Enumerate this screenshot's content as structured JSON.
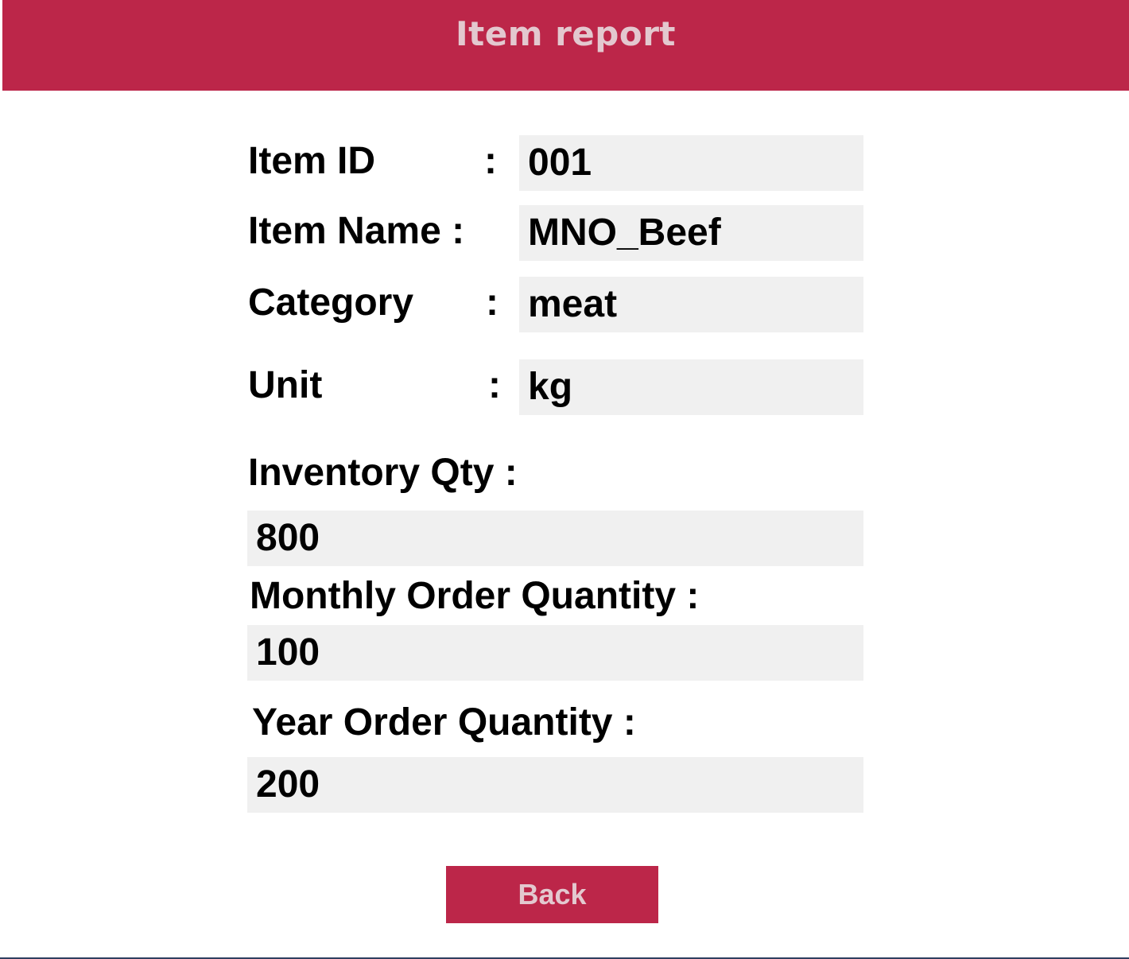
{
  "header": {
    "title": "Item report"
  },
  "fields": {
    "item_id": {
      "label": "Item ID",
      "colon": ":",
      "value": "001"
    },
    "item_name": {
      "label": "Item Name :",
      "value": "MNO_Beef"
    },
    "category": {
      "label": "Category",
      "colon": ":",
      "value": "meat"
    },
    "unit": {
      "label": "Unit",
      "colon": ":",
      "value": "kg"
    },
    "inventory_qty": {
      "label": "Inventory Qty :",
      "value": "800"
    },
    "monthly_order_qty": {
      "label": "Monthly Order Quantity :",
      "value": "100"
    },
    "year_order_qty": {
      "label": "Year Order Quantity :",
      "value": "200"
    }
  },
  "actions": {
    "back_label": "Back"
  },
  "colors": {
    "accent": "#bc2649",
    "accent_text": "#e3c8cf",
    "field_background": "#f0f0f0"
  }
}
